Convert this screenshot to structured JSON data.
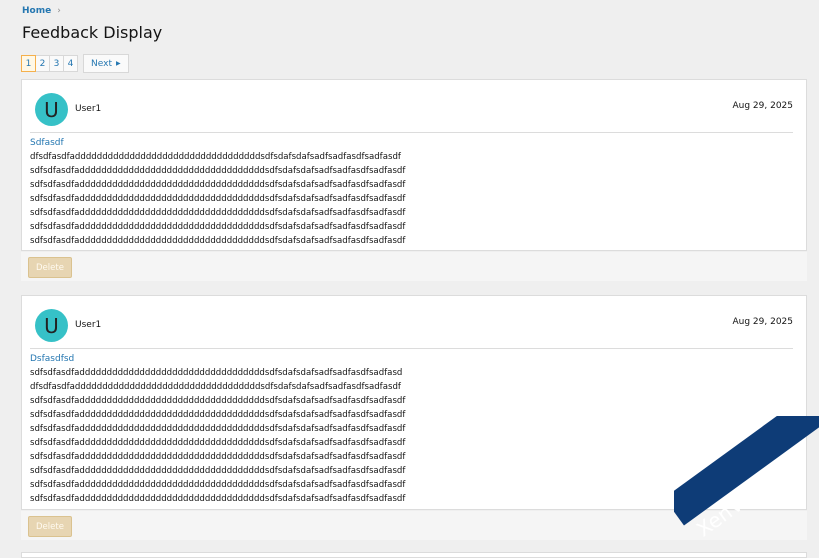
{
  "breadcrumb": {
    "home": "Home"
  },
  "page": {
    "title": "Feedback Display"
  },
  "pagination": {
    "pages": [
      "1",
      "2",
      "3",
      "4"
    ],
    "current": "1",
    "next_label": "Next"
  },
  "posts": [
    {
      "avatar_letter": "U",
      "username": "User1",
      "date": "Aug 29, 2025",
      "title": "Sdfasdf",
      "lines": [
        "dfsdfasdfaddddddddddddddddddddddddddddddddddsdfsdafsdafsadfsadfasdfsadfasdf",
        "sdfsdfasdfaddddddddddddddddddddddddddddddddddsdfsdafsdafsadfsadfasdfsadfasdf",
        "sdfsdfasdfaddddddddddddddddddddddddddddddddddsdfsdafsdafsadfsadfasdfsadfasdf",
        "sdfsdfasdfaddddddddddddddddddddddddddddddddddsdfsdafsdafsadfsadfasdfsadfasdf",
        "sdfsdfasdfaddddddddddddddddddddddddddddddddddsdfsdafsdafsadfsadfasdfsadfasdf",
        "sdfsdfasdfaddddddddddddddddddddddddddddddddddsdfsdafsdafsadfsadfasdfsadfasdf",
        "sdfsdfasdfaddddddddddddddddddddddddddddddddddsdfsdafsdafsadfsadfasdfsadfasdf"
      ],
      "delete_label": "Delete"
    },
    {
      "avatar_letter": "U",
      "username": "User1",
      "date": "Aug 29, 2025",
      "title": "Dsfasdfsd",
      "lines": [
        "sdfsdfasdfaddddddddddddddddddddddddddddddddddsdfsdafsdafsadfsadfasdfsadfasd",
        "dfsdfasdfaddddddddddddddddddddddddddddddddddsdfsdafsdafsadfsadfasdfsadfasdf",
        "sdfsdfasdfaddddddddddddddddddddddddddddddddddsdfsdafsdafsadfsadfasdfsadfasdf",
        "sdfsdfasdfaddddddddddddddddddddddddddddddddddsdfsdafsdafsadfsadfasdfsadfasdf",
        "sdfsdfasdfaddddddddddddddddddddddddddddddddddsdfsdafsdafsadfsadfasdfsadfasdf",
        "sdfsdfasdfaddddddddddddddddddddddddddddddddddsdfsdafsdafsadfsadfasdfsadfasdf",
        "sdfsdfasdfaddddddddddddddddddddddddddddddddddsdfsdafsdafsadfsadfasdfsadfasdf",
        "sdfsdfasdfaddddddddddddddddddddddddddddddddddsdfsdafsdafsadfsadfasdfsadfasdf",
        "sdfsdfasdfaddddddddddddddddddddddddddddddddddsdfsdafsdafsadfsadfasdfsadfasdf",
        "sdfsdfasdfaddddddddddddddddddddddddddddddddddsdfsdafsdafsadfsadfasdfsadfasdf"
      ],
      "delete_label": "Delete"
    }
  ],
  "watermark": {
    "text": "XenVn.Com"
  },
  "colors": {
    "link": "#2577b1",
    "avatar": "#36c1c7",
    "delete_button": "#e7d5b2",
    "pager_current_border": "#f5b04c"
  },
  "icons": {
    "breadcrumb_separator": "chevron-right-icon",
    "next_arrow": "triangle-right-icon"
  }
}
